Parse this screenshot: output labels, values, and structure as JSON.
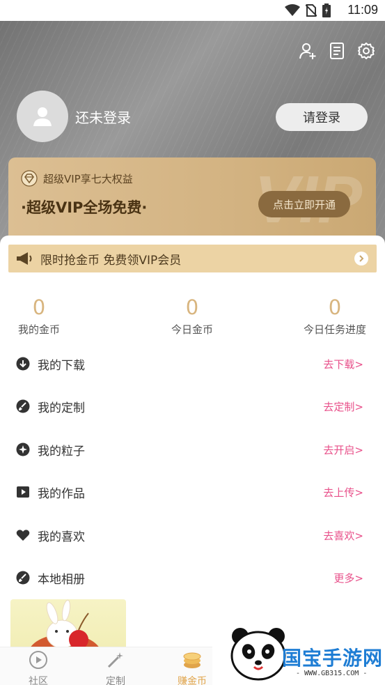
{
  "status_bar": {
    "time": "11:09"
  },
  "header": {
    "icons": [
      "add-user-icon",
      "document-icon",
      "settings-icon"
    ]
  },
  "login": {
    "name": "还未登录",
    "button_label": "请登录"
  },
  "vip": {
    "subtitle": "超级VIP享七大权益",
    "main_text": "·超级VIP全场免费·",
    "open_button": "点击立即开通",
    "watermark": "VIP"
  },
  "promo": {
    "text": "限时抢金币 免费领VIP会员"
  },
  "stats": [
    {
      "value": "0",
      "label": "我的金币"
    },
    {
      "value": "0",
      "label": "今日金币"
    },
    {
      "value": "0",
      "label": "今日任务进度"
    }
  ],
  "menu": [
    {
      "label": "我的下载",
      "action": "去下载>",
      "icon": "download-icon"
    },
    {
      "label": "我的定制",
      "action": "去定制>",
      "icon": "brush-icon"
    },
    {
      "label": "我的粒子",
      "action": "去开启>",
      "icon": "sparkle-icon"
    },
    {
      "label": "我的作品",
      "action": "去上传>",
      "icon": "play-icon"
    },
    {
      "label": "我的喜欢",
      "action": "去喜欢>",
      "icon": "heart-icon"
    },
    {
      "label": "本地相册",
      "action": "更多>",
      "icon": "brush-icon"
    }
  ],
  "bottom_nav": [
    {
      "label": "社区",
      "icon": "play-circle-icon",
      "active": false
    },
    {
      "label": "定制",
      "icon": "magic-wand-icon",
      "active": false
    },
    {
      "label": "赚金币",
      "icon": "coins-icon",
      "active": true
    }
  ],
  "watermark_logo": {
    "title": "国宝手游网",
    "url": "- WWW.GB315.COM -"
  },
  "colors": {
    "accent_gold": "#d8b57f",
    "action_pink": "#e8508a",
    "vip_button": "#8a6a3f"
  }
}
